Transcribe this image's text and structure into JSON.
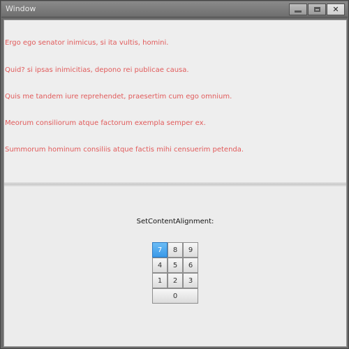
{
  "window": {
    "title": "Window",
    "minimize_icon": "minimize-icon",
    "maximize_icon": "maximize-icon",
    "close_glyph": "✕"
  },
  "text_pane": {
    "color": "#e15a5a",
    "lines": [
      "Ergo ego senator inimicus, si ita vultis, homini.",
      "Quid? si ipsas inimicitias, depono rei publicae causa.",
      "Quis me tandem iure reprehendet, praesertim cum ego omnium.",
      "Meorum consiliorum atque factorum exempla semper ex.",
      "Summorum hominum consiliis atque factis mihi censuerim petenda."
    ]
  },
  "alignment": {
    "label": "SetContentAlignment:",
    "selected": "7",
    "accent": "#3a99e8",
    "keys": [
      [
        "7",
        "8",
        "9"
      ],
      [
        "4",
        "5",
        "6"
      ],
      [
        "1",
        "2",
        "3"
      ],
      [
        "0"
      ]
    ]
  }
}
